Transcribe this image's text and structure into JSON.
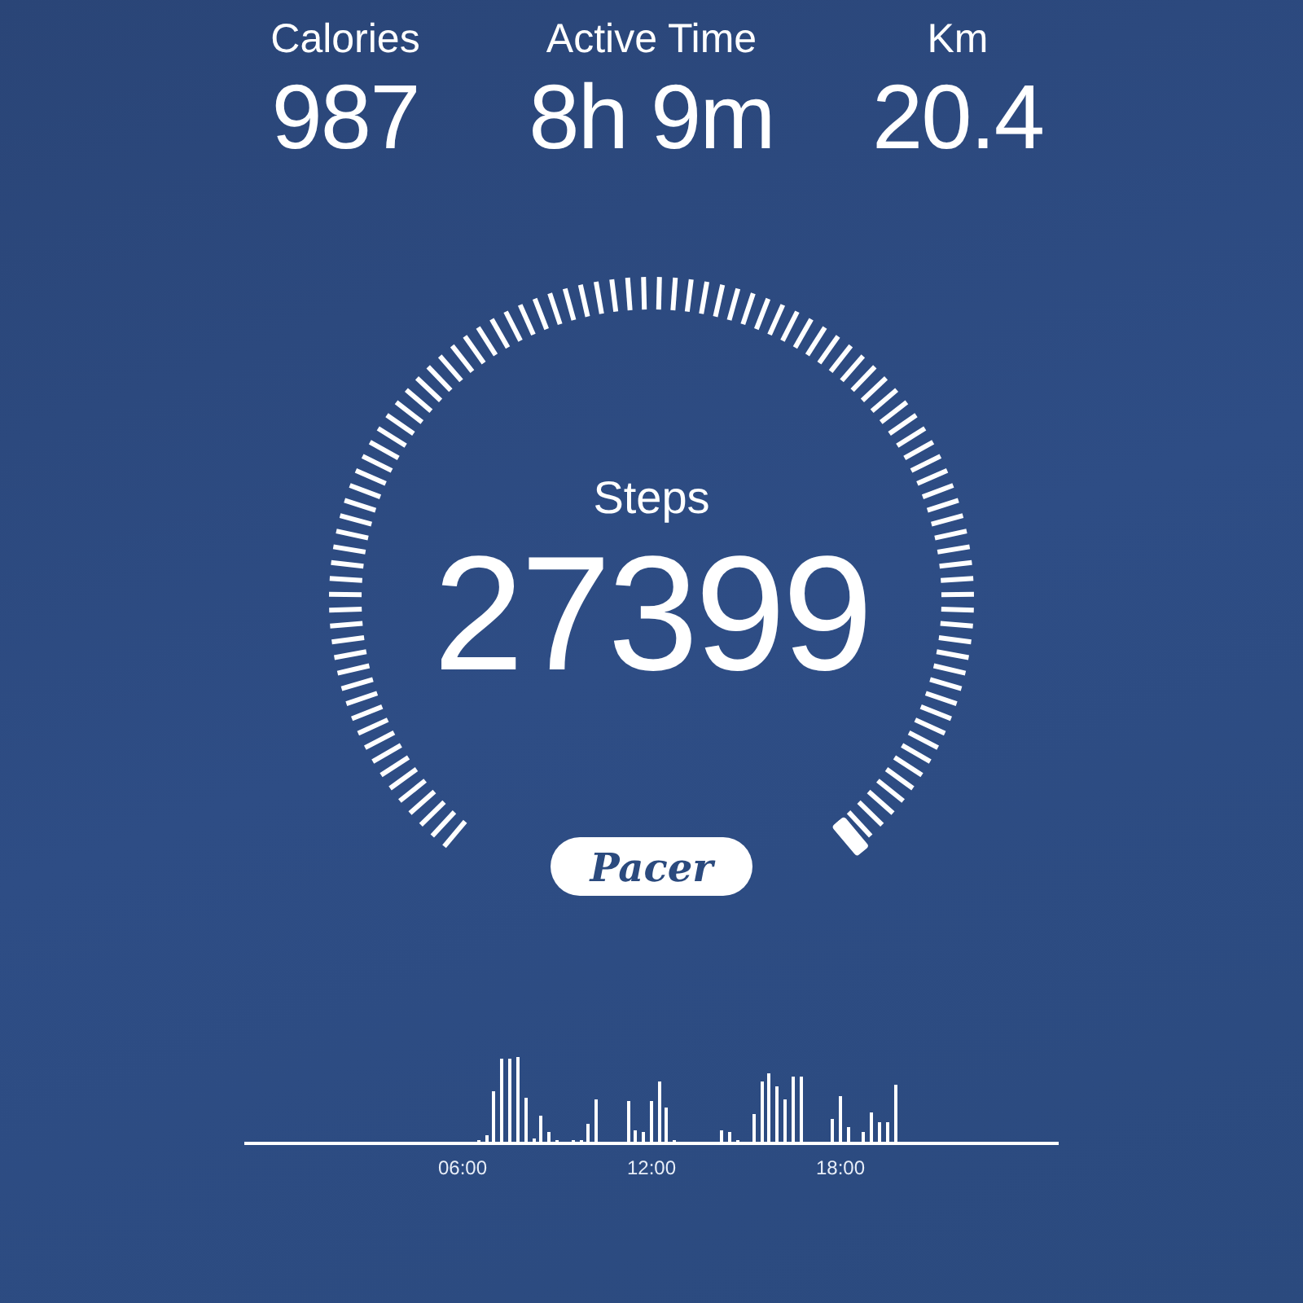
{
  "stats": [
    {
      "label": "Calories",
      "value": "987"
    },
    {
      "label": "Active Time",
      "value": "8h 9m"
    },
    {
      "label": "Km",
      "value": "20.4"
    }
  ],
  "gauge": {
    "label": "Steps",
    "value": "27399"
  },
  "badge": {
    "text": "Pacer"
  },
  "activity_chart": {
    "axis_labels": [
      "06:00",
      "12:00",
      "18:00"
    ]
  }
}
